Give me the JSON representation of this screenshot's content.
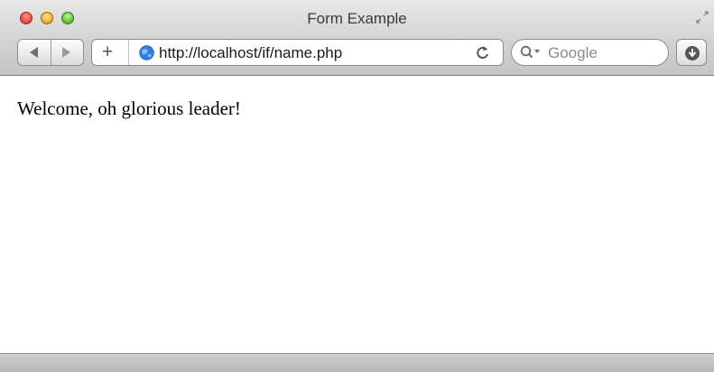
{
  "window": {
    "title": "Form Example"
  },
  "toolbar": {
    "url": "http://localhost/if/name.php",
    "search_placeholder": "Google",
    "icons": {
      "back": "back-arrow-icon",
      "forward": "forward-arrow-icon",
      "add": "plus-icon",
      "site": "globe-icon",
      "reload": "reload-icon",
      "search": "magnifier-icon",
      "download": "download-icon",
      "fullscreen": "fullscreen-icon"
    }
  },
  "page": {
    "message": "Welcome, oh glorious leader!"
  },
  "colors": {
    "close": "#f0504a",
    "minimize": "#f4b73a",
    "maximize": "#69c841",
    "globe": "#2f7fe0"
  }
}
